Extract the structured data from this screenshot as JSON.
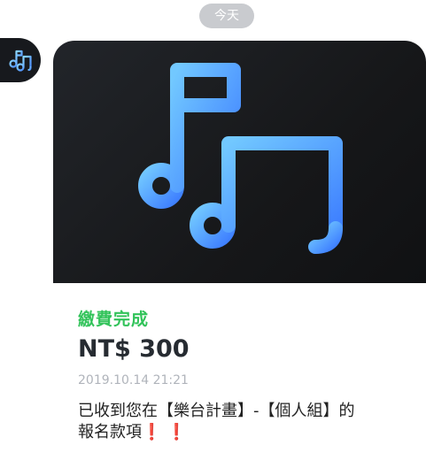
{
  "date_divider": {
    "label": "今天"
  },
  "sender": {
    "avatar_icon": "music-notes-icon"
  },
  "card": {
    "hero_icon": "music-notes-icon",
    "status": "繳費完成",
    "amount": "NT$ 300",
    "timestamp": "2019.10.14 21:21",
    "message_line1": "已收到您在【樂台計畫】-【個人組】的",
    "message_line2": "報名款項❗️ ❗️"
  },
  "colors": {
    "accent_green": "#32c35a",
    "icon_blue_start": "#72c8ff",
    "icon_blue_end": "#3e7fff",
    "hero_bg": "#17191d",
    "pill_gray": "#c9cbcf"
  }
}
